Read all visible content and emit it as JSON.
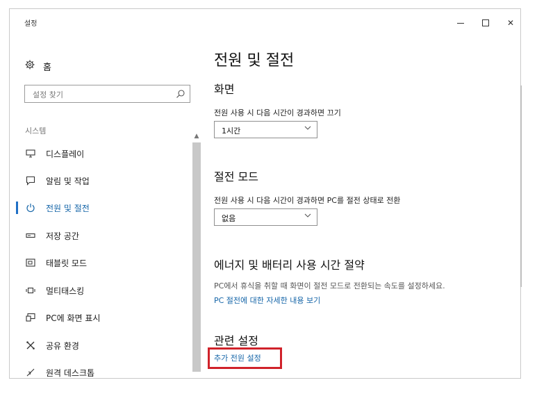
{
  "window": {
    "title": "설정",
    "minimize_icon": "minimize-icon",
    "maximize_icon": "maximize-icon",
    "close_icon": "close-icon"
  },
  "sidebar": {
    "home_label": "홈",
    "home_icon": "gear-icon",
    "search_placeholder": "설정 찾기",
    "section_label": "시스템",
    "items": [
      {
        "label": "디스플레이",
        "icon": "monitor-icon"
      },
      {
        "label": "알림 및 작업",
        "icon": "notification-icon"
      },
      {
        "label": "전원 및 절전",
        "icon": "power-icon",
        "active": true
      },
      {
        "label": "저장 공간",
        "icon": "storage-icon"
      },
      {
        "label": "태블릿 모드",
        "icon": "tablet-icon"
      },
      {
        "label": "멀티태스킹",
        "icon": "multitasking-icon"
      },
      {
        "label": "PC에 화면 표시",
        "icon": "projecting-icon"
      },
      {
        "label": "공유 환경",
        "icon": "shared-experiences-icon"
      },
      {
        "label": "원격 데스크톱",
        "icon": "remote-desktop-icon"
      }
    ]
  },
  "content": {
    "page_title": "전원 및 절전",
    "screen": {
      "heading": "화면",
      "description": "전원 사용 시 다음 시간이 경과하면 끄기",
      "selected": "1시간"
    },
    "sleep": {
      "heading": "절전 모드",
      "description": "전원 사용 시 다음 시간이 경과하면 PC를 절전 상태로 전환",
      "selected": "없음"
    },
    "energy": {
      "heading": "에너지 및 배터리 사용 시간 절약",
      "description": "PC에서 휴식을 취할 때 화면이 절전 모드로 전환되는 속도를 설정하세요.",
      "link": "PC 절전에 대한 자세한 내용 보기"
    },
    "related": {
      "heading": "관련 설정",
      "link": "추가 전원 설정"
    }
  },
  "colors": {
    "accent": "#1565a8",
    "highlight_box": "#d0222a"
  }
}
